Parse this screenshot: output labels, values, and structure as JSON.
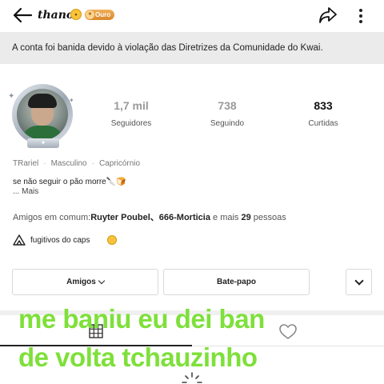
{
  "header": {
    "username": "thanos",
    "emoji_badge": "😯",
    "level_badge": "Ouro",
    "back_icon": "arrow-left-icon",
    "share_icon": "share-arrow-icon",
    "more_icon": "more-vertical-icon"
  },
  "ban_notice": "A conta foi banida devido à violação das Diretrizes da Comunidade do Kwai.",
  "stats": [
    {
      "value": "1,7 mil",
      "label": "Seguidores"
    },
    {
      "value": "738",
      "label": "Seguindo"
    },
    {
      "value": "833",
      "label": "Curtidas"
    }
  ],
  "meta": {
    "name": "TRariel",
    "gender": "Masculino",
    "sign": "Capricórnio"
  },
  "bio": {
    "text": "se não seguir o pão morre🔪🍞",
    "more": "...  Mais"
  },
  "mutual": {
    "prefix": "Amigos em comum:",
    "names": "Ruyter Poubel、666-Morticia",
    "middle": " e mais ",
    "count": "29",
    "suffix": " pessoas"
  },
  "group": {
    "name": "fugitivos do caps",
    "emoji": "😝"
  },
  "buttons": {
    "friends": "Amigos",
    "chat": "Bate-papo"
  },
  "overlay_caption": {
    "line1": "me baniu eu dei ban",
    "line2": "de volta tchauzinho"
  },
  "colors": {
    "caption": "#7ee03a",
    "banner_bg": "#ebebeb",
    "badge_gold": "#d98729"
  }
}
